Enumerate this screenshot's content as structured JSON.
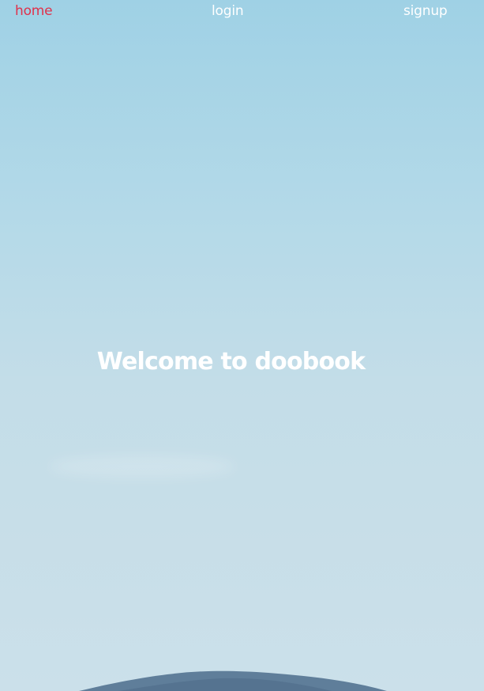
{
  "nav": {
    "home_label": "home",
    "login_label": "login",
    "signup_label": "signup"
  },
  "hero": {
    "title": "Welcome to doobook"
  },
  "colors": {
    "active_link": "#e0314b",
    "text": "#ffffff",
    "sky_top": "#9fd1e5",
    "sky_bottom": "#cbe0ea",
    "mountain": "#5f7e9a"
  }
}
